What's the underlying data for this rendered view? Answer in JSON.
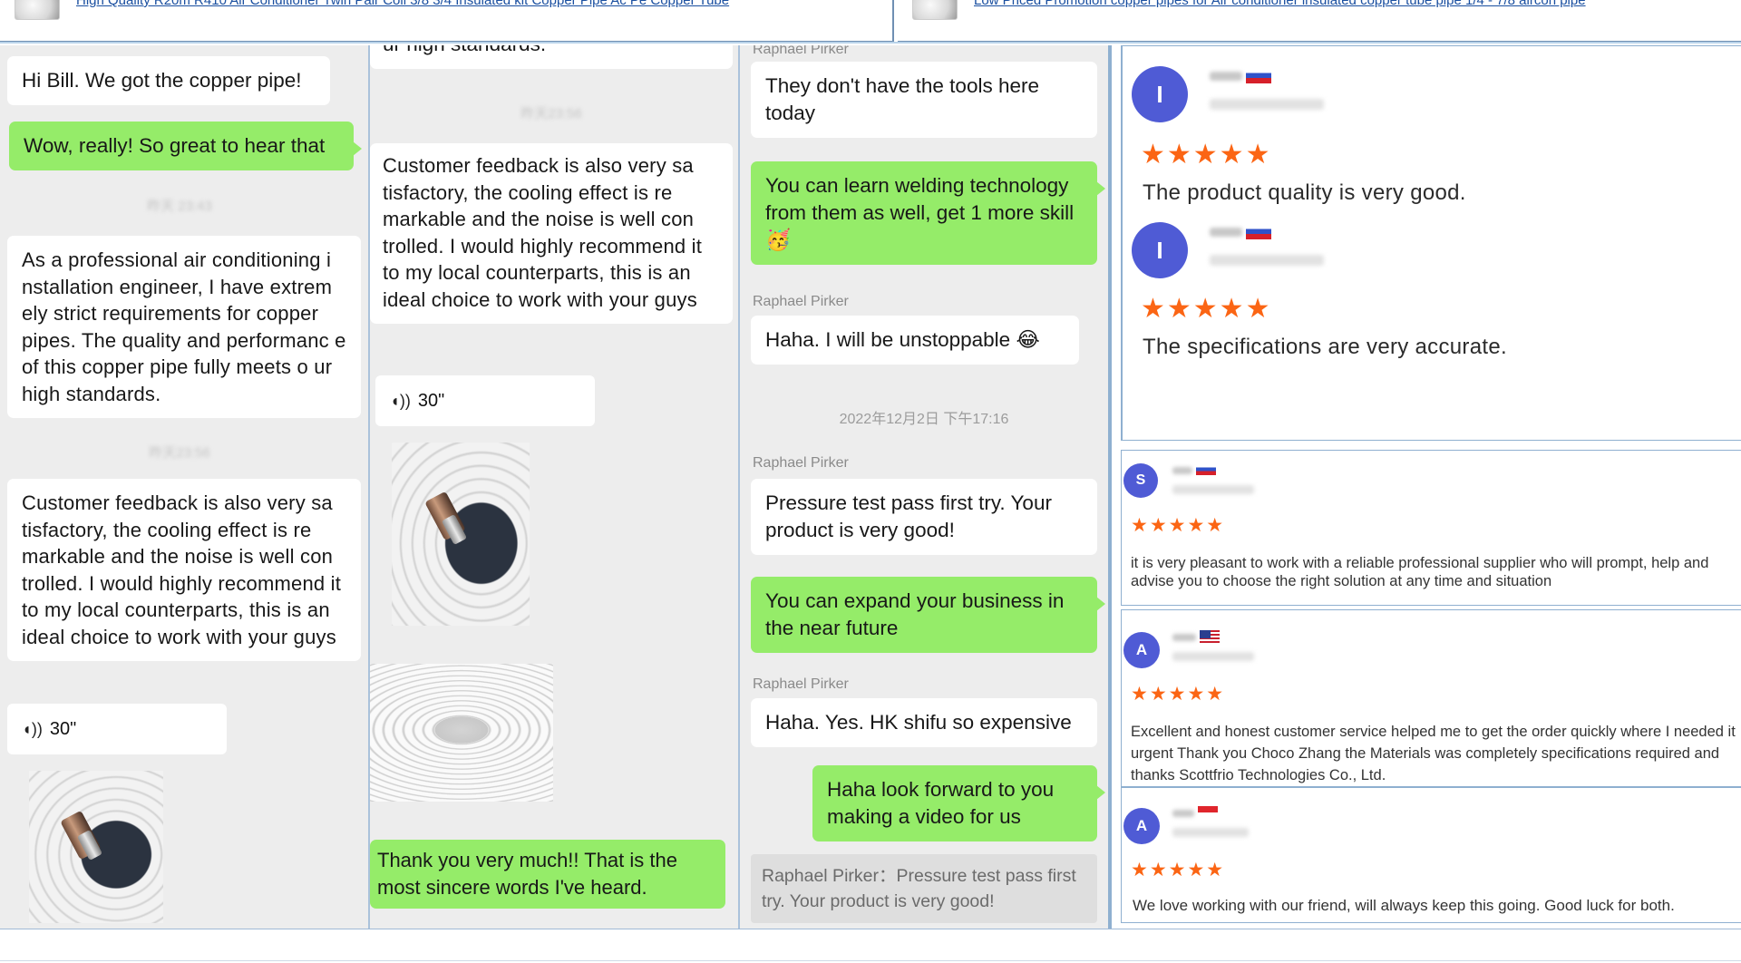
{
  "products": [
    {
      "title": "High Quality R20m R410 Air Conditioner Twin Pair Coil 3/8 3/4 Insulated kit Copper Pipe Ac Pe Copper Tube"
    },
    {
      "title": "Low Priced Promotion copper pipes for Air conditioner insulated copper tube pipe 1/4 - 7/8 aircon pipe"
    }
  ],
  "chat1": {
    "msg_hi": "Hi Bill. We got the copper pipe!",
    "msg_wow": "Wow, really! So great to hear that",
    "time1": "昨天 23:43",
    "msg_engineer": "As a professional air conditioning i nstallation engineer, I have extrem ely strict requirements for copper pipes. The quality and performanc e of this copper pipe fully meets o ur high standards.",
    "time2": "昨天23:56",
    "msg_feedback": "Customer feedback is also very sa tisfactory, the cooling effect is re markable and the noise is well con trolled. I would highly recommend it to my local counterparts, this is an ideal choice to work with your guys",
    "voice": "30\""
  },
  "chat2": {
    "msg_tail": "ur high standards.",
    "time1": "昨天23:56",
    "msg_feedback": "Customer feedback is also very sa tisfactory, the cooling effect is re markable and the noise is well con trolled. I would highly recommend it to my local counterparts, this is an ideal choice to work with your guys",
    "voice": "30\"",
    "msg_thanks": "Thank you very much!! That is the most sincere words I've heard."
  },
  "chat3": {
    "sender": "Raphael Pirker",
    "msg_tools": "They don't have the tools here today",
    "msg_learn": "You can learn welding technology from them as well, get 1 more skill🥳",
    "msg_unstoppable": "Haha. I will be unstoppable 😂",
    "timestamp": "2022年12月2日 下午17:16",
    "msg_pressure": "Pressure test pass first try. Your product is very good!",
    "msg_expand": "You can expand your business in the near future",
    "msg_shifu": "Haha. Yes. HK shifu so expensive",
    "msg_video": "Haha look forward to you making a video for us",
    "quote": "Raphael Pirker：Pressure test pass first try. Your product is very good!"
  },
  "reviews": [
    {
      "avatar_letter": "I",
      "stars": "★★★★★",
      "text": "The product quality is very good.",
      "flag": "ru"
    },
    {
      "avatar_letter": "I",
      "stars": "★★★★★",
      "text": "The specifications are very accurate.",
      "flag": "ru"
    },
    {
      "avatar_letter": "S",
      "stars": "★★★★★",
      "text": "it is very pleasant to work with a reliable professional supplier who will prompt, help and advise you to choose the right solution at any time and situation",
      "flag": "ru"
    },
    {
      "avatar_letter": "A",
      "stars": "★★★★★",
      "text": "Excellent and honest customer service helped me to get the order quickly where I needed it urgent Thank you Choco Zhang the Materials was completely specifications required and thanks Scottfrio Technologies Co., Ltd.",
      "flag": "us"
    },
    {
      "avatar_letter": "A",
      "stars": "★★★★★",
      "text": "We love working with our friend, will always keep this going. Good luck for both.",
      "flag": "sg"
    }
  ],
  "colors": {
    "chat_bg": "#ededed",
    "bubble_green": "#95ec69",
    "star": "#fb6514",
    "avatar": "#4f5bd5",
    "link": "#1a4fa0"
  }
}
